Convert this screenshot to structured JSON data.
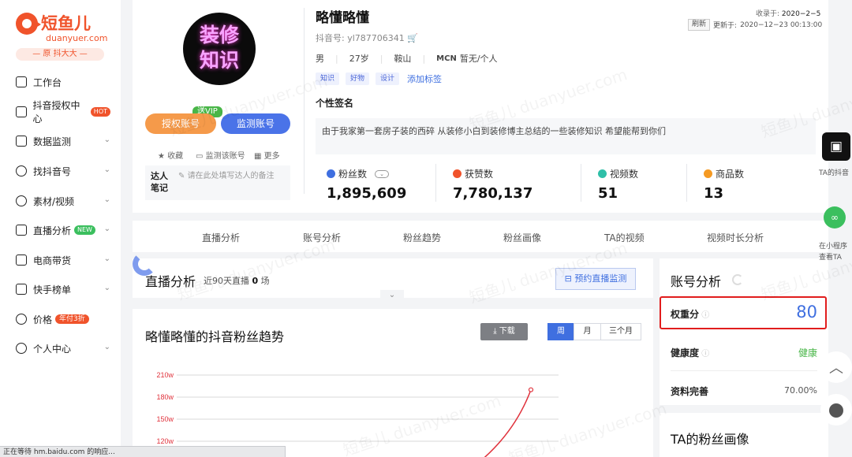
{
  "brand": {
    "name": "短鱼儿",
    "domain": "duanyuer.com",
    "slogan": "— 原 抖大大 —",
    "color": "#f0532b"
  },
  "nav": [
    {
      "label": "工作台",
      "icon": "monitor-icon"
    },
    {
      "label": "抖音授权中心",
      "icon": "shield-icon",
      "badge": "HOT"
    },
    {
      "label": "数据监测",
      "icon": "chart-icon",
      "chevron": "⌄"
    },
    {
      "label": "找抖音号",
      "icon": "search-icon",
      "chevron": "⌄"
    },
    {
      "label": "素材/视频",
      "icon": "bulb-icon",
      "chevron": "⌄"
    },
    {
      "label": "直播分析",
      "icon": "live-icon",
      "badge": "NEW",
      "chevron": "⌄"
    },
    {
      "label": "电商带货",
      "icon": "cart-icon",
      "chevron": "⌄"
    },
    {
      "label": "快手榜单",
      "icon": "kuaishou-icon",
      "chevron": "⌄"
    },
    {
      "label": "价格",
      "icon": "yuan-icon",
      "badge": "年付3折"
    },
    {
      "label": "个人中心",
      "icon": "user-icon",
      "chevron": "⌄"
    }
  ],
  "profile": {
    "avatar_text_1": "装修",
    "avatar_text_2": "知识",
    "name": "略懂略懂",
    "douyin_id_label": "抖音号:",
    "douyin_id": "yl787706341",
    "gender": "男",
    "age": "27岁",
    "location": "鞍山",
    "mcn_label": "MCN",
    "mcn_value": "暂无/个人",
    "tags": [
      "知识",
      "好物",
      "设计"
    ],
    "add_tag": "添加标签",
    "collected_label": "收录于:",
    "collected_date": "2020−2−5",
    "refresh": "刷新",
    "updated_label": "更新于:",
    "updated_at": "2020−12−23 00:13:00",
    "vip_badge": "送VIP",
    "authorize_btn": "授权账号",
    "monitor_btn": "监测账号",
    "collect_link": "收藏",
    "monitor_link": "监测该账号",
    "more_link": "更多",
    "note_label_1": "达人",
    "note_label_2": "笔记",
    "note_placeholder": "请在此处填写达人的备注",
    "signature_title": "个性签名",
    "signature": "由于我家第一套房子装的西碎 从装修小白到装修博主总结的一些装修知识 希望能帮到你们",
    "stats": [
      {
        "label": "粉丝数",
        "value": "1,895,609",
        "color": "#3f6fe0"
      },
      {
        "label": "获赞数",
        "value": "7,780,137",
        "color": "#f0532b"
      },
      {
        "label": "视频数",
        "value": "51",
        "color": "#2fbfa8"
      },
      {
        "label": "商品数",
        "value": "13",
        "color": "#f59a23"
      }
    ]
  },
  "tabs": [
    "直播分析",
    "账号分析",
    "粉丝趋势",
    "粉丝画像",
    "TA的视频",
    "视频时长分析"
  ],
  "live": {
    "title": "直播分析",
    "subtitle_prefix": "近90天直播",
    "count": "0",
    "subtitle_suffix": "场",
    "reserve_btn": "预约直播监测"
  },
  "trend": {
    "title": "略懂略懂的抖音粉丝趋势",
    "download": "下载",
    "ranges": [
      "周",
      "月",
      "三个月"
    ],
    "active_range": "周"
  },
  "chart_data": {
    "type": "line",
    "title": "",
    "ytick_labels": [
      "210w",
      "180w",
      "150w",
      "120w"
    ],
    "series": [
      {
        "values": [
          190
        ]
      }
    ],
    "color": "#e0323c"
  },
  "account": {
    "title": "账号分析",
    "weight_label": "权重分",
    "weight_value": "80",
    "health_label": "健康度",
    "health_value": "健康",
    "complete_label": "资料完善",
    "complete_value": "70.00%"
  },
  "fans_portrait": {
    "title": "TA的粉丝画像"
  },
  "rightfloat": {
    "douyin": "TA的抖音",
    "miniapp_1": "在小程序",
    "miniapp_2": "查看TA"
  },
  "watermark": "短鱼儿 duanyuer.com",
  "statusbar": "正在等待 hm.baidu.com 的响应..."
}
